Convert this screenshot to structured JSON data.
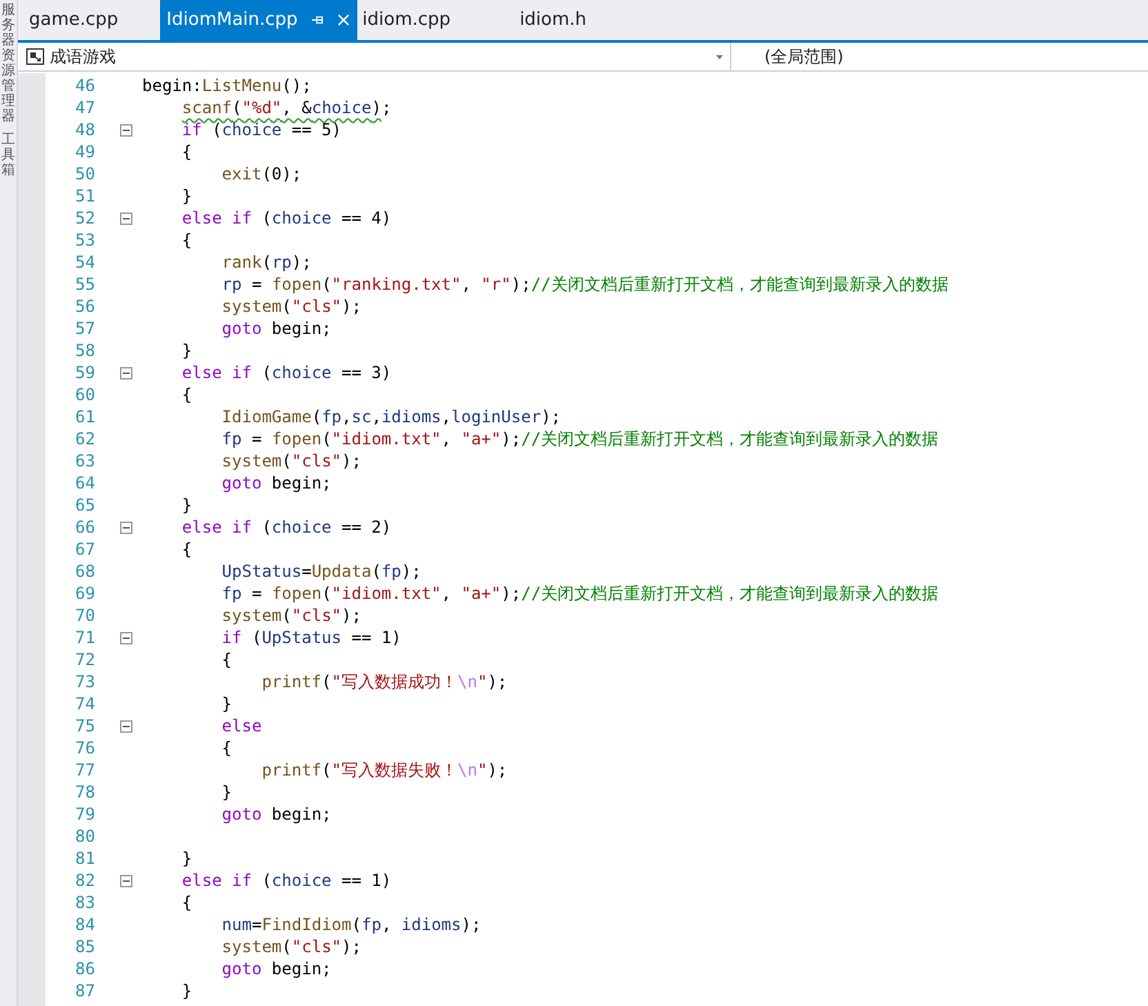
{
  "side_panel": {
    "items": [
      "服务器资源管理器",
      "工具箱"
    ]
  },
  "tabs": [
    {
      "label": "game.cpp",
      "selected": false
    },
    {
      "label": "IdiomMain.cpp",
      "selected": true
    },
    {
      "label": "idiom.cpp",
      "selected": false
    },
    {
      "label": "idiom.h",
      "selected": false
    }
  ],
  "nav_bar": {
    "project": "成语游戏",
    "scope": "(全局范围)"
  },
  "lines": [
    {
      "number": "46",
      "fold": false,
      "warning": false,
      "tokens": [
        {
          "kind": "txt",
          "text": "begin:"
        },
        {
          "kind": "fn",
          "text": "ListMenu"
        },
        {
          "kind": "txt",
          "text": "();"
        }
      ],
      "children": [
        {
          "number": "47",
          "fold": false,
          "warning": true,
          "tokens": [
            {
              "kind": "fn",
              "text": "scanf"
            },
            {
              "kind": "txt",
              "text": "("
            },
            {
              "kind": "str",
              "text": "\"%d\""
            },
            {
              "kind": "txt",
              "text": ", &"
            },
            {
              "kind": "id",
              "text": "choice"
            },
            {
              "kind": "txt",
              "text": ")"
            }
          ],
          "after": ";"
        },
        {
          "number": "48",
          "fold": true,
          "warning": false,
          "tokens": [
            {
              "kind": "kw",
              "text": "if"
            },
            {
              "kind": "txt",
              "text": " ("
            },
            {
              "kind": "id",
              "text": "choice"
            },
            {
              "kind": "txt",
              "text": " == 5)"
            }
          ]
        },
        {
          "number": "49",
          "fold": false,
          "warning": false,
          "tokens": [
            {
              "kind": "txt",
              "text": "{"
            }
          ],
          "children": [
            {
              "number": "50",
              "fold": false,
              "warning": false,
              "tokens": [
                {
                  "kind": "fn",
                  "text": "exit"
                },
                {
                  "kind": "txt",
                  "text": "(0);"
                }
              ]
            }
          ]
        },
        {
          "number": "51",
          "fold": false,
          "warning": false,
          "tokens": [
            {
              "kind": "txt",
              "text": "}"
            }
          ]
        },
        {
          "number": "52",
          "fold": true,
          "warning": false,
          "tokens": [
            {
              "kind": "kw",
              "text": "else if"
            },
            {
              "kind": "txt",
              "text": " ("
            },
            {
              "kind": "id",
              "text": "choice"
            },
            {
              "kind": "txt",
              "text": " == 4)"
            }
          ]
        },
        {
          "number": "53",
          "fold": false,
          "warning": false,
          "tokens": [
            {
              "kind": "txt",
              "text": "{"
            }
          ],
          "children": [
            {
              "number": "54",
              "fold": false,
              "warning": false,
              "tokens": [
                {
                  "kind": "fn",
                  "text": "rank"
                },
                {
                  "kind": "txt",
                  "text": "("
                },
                {
                  "kind": "id",
                  "text": "rp"
                },
                {
                  "kind": "txt",
                  "text": ");"
                }
              ]
            },
            {
              "number": "55",
              "fold": false,
              "warning": false,
              "tokens": [
                {
                  "kind": "id",
                  "text": "rp"
                },
                {
                  "kind": "txt",
                  "text": " = "
                },
                {
                  "kind": "fn",
                  "text": "fopen"
                },
                {
                  "kind": "txt",
                  "text": "("
                },
                {
                  "kind": "str",
                  "text": "\"ranking.txt\""
                },
                {
                  "kind": "txt",
                  "text": ", "
                },
                {
                  "kind": "str",
                  "text": "\"r\""
                },
                {
                  "kind": "txt",
                  "text": ");"
                },
                {
                  "kind": "cmt",
                  "text": "//关闭文档后重新打开文档，才能查询到最新录入的数据"
                }
              ]
            },
            {
              "number": "56",
              "fold": false,
              "warning": false,
              "tokens": [
                {
                  "kind": "fn",
                  "text": "system"
                },
                {
                  "kind": "txt",
                  "text": "("
                },
                {
                  "kind": "str",
                  "text": "\"cls\""
                },
                {
                  "kind": "txt",
                  "text": ");"
                }
              ]
            },
            {
              "number": "57",
              "fold": false,
              "warning": false,
              "tokens": [
                {
                  "kind": "kw",
                  "text": "goto"
                },
                {
                  "kind": "txt",
                  "text": " begin;"
                }
              ]
            }
          ]
        },
        {
          "number": "58",
          "fold": false,
          "warning": false,
          "tokens": [
            {
              "kind": "txt",
              "text": "}"
            }
          ]
        },
        {
          "number": "59",
          "fold": true,
          "warning": false,
          "tokens": [
            {
              "kind": "kw",
              "text": "else if"
            },
            {
              "kind": "txt",
              "text": " ("
            },
            {
              "kind": "id",
              "text": "choice"
            },
            {
              "kind": "txt",
              "text": " == 3)"
            }
          ]
        },
        {
          "number": "60",
          "fold": false,
          "warning": false,
          "tokens": [
            {
              "kind": "txt",
              "text": "{"
            }
          ],
          "children": [
            {
              "number": "61",
              "fold": false,
              "warning": false,
              "tokens": [
                {
                  "kind": "fn",
                  "text": "IdiomGame"
                },
                {
                  "kind": "txt",
                  "text": "("
                },
                {
                  "kind": "id",
                  "text": "fp"
                },
                {
                  "kind": "txt",
                  "text": ","
                },
                {
                  "kind": "id",
                  "text": "sc"
                },
                {
                  "kind": "txt",
                  "text": ","
                },
                {
                  "kind": "id",
                  "text": "idioms"
                },
                {
                  "kind": "txt",
                  "text": ","
                },
                {
                  "kind": "id",
                  "text": "loginUser"
                },
                {
                  "kind": "txt",
                  "text": ");"
                }
              ]
            },
            {
              "number": "62",
              "fold": false,
              "warning": false,
              "tokens": [
                {
                  "kind": "id",
                  "text": "fp"
                },
                {
                  "kind": "txt",
                  "text": " = "
                },
                {
                  "kind": "fn",
                  "text": "fopen"
                },
                {
                  "kind": "txt",
                  "text": "("
                },
                {
                  "kind": "str",
                  "text": "\"idiom.txt\""
                },
                {
                  "kind": "txt",
                  "text": ", "
                },
                {
                  "kind": "str",
                  "text": "\"a+\""
                },
                {
                  "kind": "txt",
                  "text": ");"
                },
                {
                  "kind": "cmt",
                  "text": "//关闭文档后重新打开文档，才能查询到最新录入的数据"
                }
              ]
            },
            {
              "number": "63",
              "fold": false,
              "warning": false,
              "tokens": [
                {
                  "kind": "fn",
                  "text": "system"
                },
                {
                  "kind": "txt",
                  "text": "("
                },
                {
                  "kind": "str",
                  "text": "\"cls\""
                },
                {
                  "kind": "txt",
                  "text": ");"
                }
              ]
            },
            {
              "number": "64",
              "fold": false,
              "warning": false,
              "tokens": [
                {
                  "kind": "kw",
                  "text": "goto"
                },
                {
                  "kind": "txt",
                  "text": " begin;"
                }
              ]
            }
          ]
        },
        {
          "number": "65",
          "fold": false,
          "warning": false,
          "tokens": [
            {
              "kind": "txt",
              "text": "}"
            }
          ]
        },
        {
          "number": "66",
          "fold": true,
          "warning": false,
          "tokens": [
            {
              "kind": "kw",
              "text": "else if"
            },
            {
              "kind": "txt",
              "text": " ("
            },
            {
              "kind": "id",
              "text": "choice"
            },
            {
              "kind": "txt",
              "text": " == 2)"
            }
          ]
        },
        {
          "number": "67",
          "fold": false,
          "warning": false,
          "tokens": [
            {
              "kind": "txt",
              "text": "{"
            }
          ],
          "children": [
            {
              "number": "68",
              "fold": false,
              "warning": false,
              "tokens": [
                {
                  "kind": "id",
                  "text": "UpStatus"
                },
                {
                  "kind": "txt",
                  "text": "="
                },
                {
                  "kind": "fn",
                  "text": "Updata"
                },
                {
                  "kind": "txt",
                  "text": "("
                },
                {
                  "kind": "id",
                  "text": "fp"
                },
                {
                  "kind": "txt",
                  "text": ");"
                }
              ]
            },
            {
              "number": "69",
              "fold": false,
              "warning": false,
              "tokens": [
                {
                  "kind": "id",
                  "text": "fp"
                },
                {
                  "kind": "txt",
                  "text": " = "
                },
                {
                  "kind": "fn",
                  "text": "fopen"
                },
                {
                  "kind": "txt",
                  "text": "("
                },
                {
                  "kind": "str",
                  "text": "\"idiom.txt\""
                },
                {
                  "kind": "txt",
                  "text": ", "
                },
                {
                  "kind": "str",
                  "text": "\"a+\""
                },
                {
                  "kind": "txt",
                  "text": ");"
                },
                {
                  "kind": "cmt",
                  "text": "//关闭文档后重新打开文档，才能查询到最新录入的数据"
                }
              ]
            },
            {
              "number": "70",
              "fold": false,
              "warning": false,
              "tokens": [
                {
                  "kind": "fn",
                  "text": "system"
                },
                {
                  "kind": "txt",
                  "text": "("
                },
                {
                  "kind": "str",
                  "text": "\"cls\""
                },
                {
                  "kind": "txt",
                  "text": ");"
                }
              ]
            },
            {
              "number": "71",
              "fold": true,
              "warning": false,
              "tokens": [
                {
                  "kind": "kw",
                  "text": "if"
                },
                {
                  "kind": "txt",
                  "text": " ("
                },
                {
                  "kind": "id",
                  "text": "UpStatus"
                },
                {
                  "kind": "txt",
                  "text": " == 1)"
                }
              ]
            },
            {
              "number": "72",
              "fold": false,
              "warning": false,
              "tokens": [
                {
                  "kind": "txt",
                  "text": "{"
                }
              ],
              "children": [
                {
                  "number": "73",
                  "fold": false,
                  "warning": false,
                  "tokens": [
                    {
                      "kind": "fn",
                      "text": "printf"
                    },
                    {
                      "kind": "txt",
                      "text": "("
                    },
                    {
                      "kind": "str",
                      "text": "\"写入数据成功！"
                    },
                    {
                      "kind": "esc",
                      "text": "\\n"
                    },
                    {
                      "kind": "str",
                      "text": "\""
                    },
                    {
                      "kind": "txt",
                      "text": ");"
                    }
                  ]
                }
              ]
            },
            {
              "number": "74",
              "fold": false,
              "warning": false,
              "tokens": [
                {
                  "kind": "txt",
                  "text": "}"
                }
              ]
            },
            {
              "number": "75",
              "fold": true,
              "warning": false,
              "tokens": [
                {
                  "kind": "kw",
                  "text": "else"
                }
              ]
            },
            {
              "number": "76",
              "fold": false,
              "warning": false,
              "tokens": [
                {
                  "kind": "txt",
                  "text": "{"
                }
              ],
              "children": [
                {
                  "number": "77",
                  "fold": false,
                  "warning": false,
                  "tokens": [
                    {
                      "kind": "fn",
                      "text": "printf"
                    },
                    {
                      "kind": "txt",
                      "text": "("
                    },
                    {
                      "kind": "str",
                      "text": "\"写入数据失败！"
                    },
                    {
                      "kind": "esc",
                      "text": "\\n"
                    },
                    {
                      "kind": "str",
                      "text": "\""
                    },
                    {
                      "kind": "txt",
                      "text": ");"
                    }
                  ]
                }
              ]
            },
            {
              "number": "78",
              "fold": false,
              "warning": false,
              "tokens": [
                {
                  "kind": "txt",
                  "text": "}"
                }
              ]
            },
            {
              "number": "79",
              "fold": false,
              "warning": false,
              "tokens": [
                {
                  "kind": "kw",
                  "text": "goto"
                },
                {
                  "kind": "txt",
                  "text": " begin;"
                }
              ]
            },
            {
              "number": "80",
              "fold": false,
              "warning": false
            }
          ]
        },
        {
          "number": "81",
          "fold": false,
          "warning": false,
          "tokens": [
            {
              "kind": "txt",
              "text": "}"
            }
          ]
        },
        {
          "number": "82",
          "fold": true,
          "warning": false,
          "tokens": [
            {
              "kind": "kw",
              "text": "else if"
            },
            {
              "kind": "txt",
              "text": " ("
            },
            {
              "kind": "id",
              "text": "choice"
            },
            {
              "kind": "txt",
              "text": " == 1)"
            }
          ]
        },
        {
          "number": "83",
          "fold": false,
          "warning": false,
          "tokens": [
            {
              "kind": "txt",
              "text": "{"
            }
          ],
          "children": [
            {
              "number": "84",
              "fold": false,
              "warning": false,
              "tokens": [
                {
                  "kind": "id",
                  "text": "num"
                },
                {
                  "kind": "txt",
                  "text": "="
                },
                {
                  "kind": "fn",
                  "text": "FindIdiom"
                },
                {
                  "kind": "txt",
                  "text": "("
                },
                {
                  "kind": "id",
                  "text": "fp"
                },
                {
                  "kind": "txt",
                  "text": ", "
                },
                {
                  "kind": "id",
                  "text": "idioms"
                },
                {
                  "kind": "txt",
                  "text": ");"
                }
              ]
            },
            {
              "number": "85",
              "fold": false,
              "warning": false,
              "tokens": [
                {
                  "kind": "fn",
                  "text": "system"
                },
                {
                  "kind": "txt",
                  "text": "("
                },
                {
                  "kind": "str",
                  "text": "\"cls\""
                },
                {
                  "kind": "txt",
                  "text": ");"
                }
              ]
            },
            {
              "number": "86",
              "fold": false,
              "warning": false,
              "tokens": [
                {
                  "kind": "kw",
                  "text": "goto"
                },
                {
                  "kind": "txt",
                  "text": " begin;"
                }
              ]
            }
          ]
        },
        {
          "number": "87",
          "fold": false,
          "warning": false,
          "tokens": [
            {
              "kind": "txt",
              "text": "}"
            }
          ]
        }
      ]
    }
  ]
}
